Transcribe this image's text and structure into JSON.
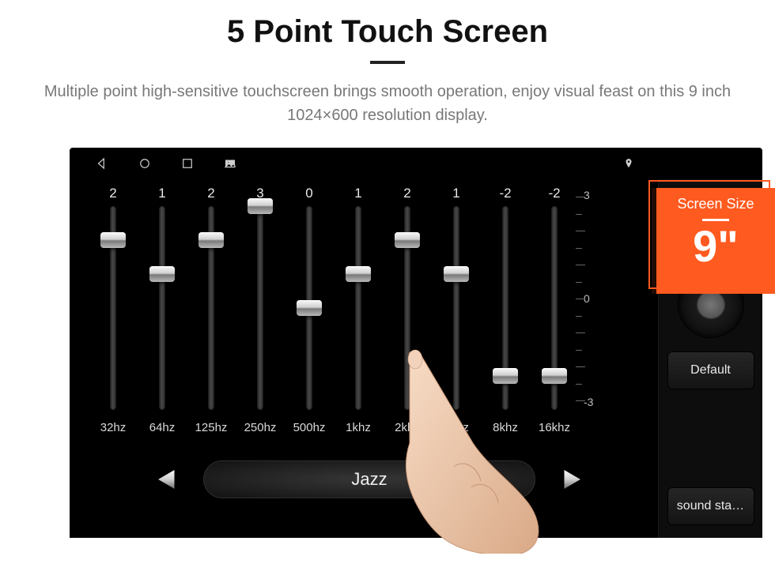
{
  "hero": {
    "title": "5 Point Touch Screen",
    "subtitle": "Multiple point high-sensitive touchscreen brings smooth operation, enjoy visual feast on this 9 inch 1024×600 resolution display."
  },
  "callout": {
    "label": "Screen Size",
    "value": "9\""
  },
  "navbar": {
    "icons": [
      "back",
      "home",
      "recent",
      "gallery"
    ],
    "right_icons": [
      "pin"
    ]
  },
  "equalizer": {
    "scale": {
      "max_label": "3",
      "mid_label": "0",
      "min_label": "-3",
      "max": 3,
      "min": -3
    },
    "bands": [
      {
        "value": 2,
        "freq": "32hz"
      },
      {
        "value": 1,
        "freq": "64hz"
      },
      {
        "value": 2,
        "freq": "125hz"
      },
      {
        "value": 3,
        "freq": "250hz"
      },
      {
        "value": 0,
        "freq": "500hz"
      },
      {
        "value": 1,
        "freq": "1khz"
      },
      {
        "value": 2,
        "freq": "2khz"
      },
      {
        "value": 1,
        "freq": "4khz"
      },
      {
        "value": -2,
        "freq": "8khz"
      },
      {
        "value": -2,
        "freq": "16khz"
      }
    ],
    "preset": "Jazz"
  },
  "side": {
    "toggle_on": false,
    "default_btn": "Default",
    "sound_btn": "sound sta…"
  }
}
